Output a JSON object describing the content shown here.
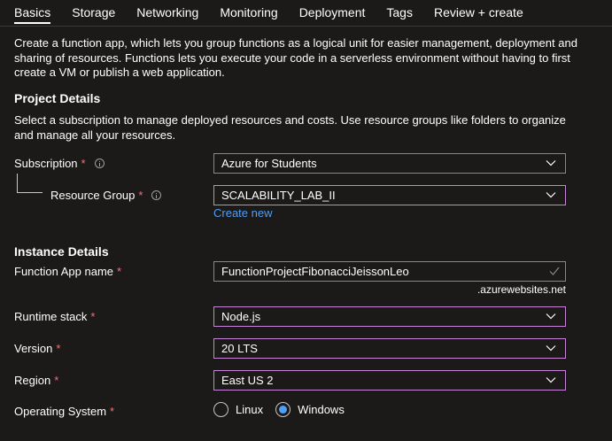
{
  "tabs": [
    {
      "label": "Basics",
      "active": true
    },
    {
      "label": "Storage",
      "active": false
    },
    {
      "label": "Networking",
      "active": false
    },
    {
      "label": "Monitoring",
      "active": false
    },
    {
      "label": "Deployment",
      "active": false
    },
    {
      "label": "Tags",
      "active": false
    },
    {
      "label": "Review + create",
      "active": false
    }
  ],
  "intro": "Create a function app, which lets you group functions as a logical unit for easier management, deployment and sharing of resources. Functions lets you execute your code in a serverless environment without having to first create a VM or publish a web application.",
  "project": {
    "heading": "Project Details",
    "description": "Select a subscription to manage deployed resources and costs. Use resource groups like folders to organize and manage all your resources.",
    "subscription": {
      "label": "Subscription",
      "required": "*",
      "value": "Azure for Students"
    },
    "resource_group": {
      "label": "Resource Group",
      "required": "*",
      "value": "SCALABILITY_LAB_II",
      "create_new": "Create new"
    }
  },
  "instance": {
    "heading": "Instance Details",
    "app_name": {
      "label": "Function App name",
      "required": "*",
      "value": "FunctionProjectFibonacciJeissonLeo",
      "suffix": ".azurewebsites.net"
    },
    "runtime": {
      "label": "Runtime stack",
      "required": "*",
      "value": "Node.js"
    },
    "version": {
      "label": "Version",
      "required": "*",
      "value": "20 LTS"
    },
    "region": {
      "label": "Region",
      "required": "*",
      "value": "East US 2"
    },
    "os": {
      "label": "Operating System",
      "required": "*",
      "options": [
        "Linux",
        "Windows"
      ],
      "selected": "Windows"
    }
  },
  "colors": {
    "background": "#1b1a19",
    "required": "#f1707b",
    "focus_border": "#c685d7",
    "link": "#4f9ef8",
    "valid_check": "#8a8886"
  },
  "icons": {
    "info": "info-icon",
    "dropdown": "chevron-down-icon",
    "valid": "checkmark-icon"
  }
}
